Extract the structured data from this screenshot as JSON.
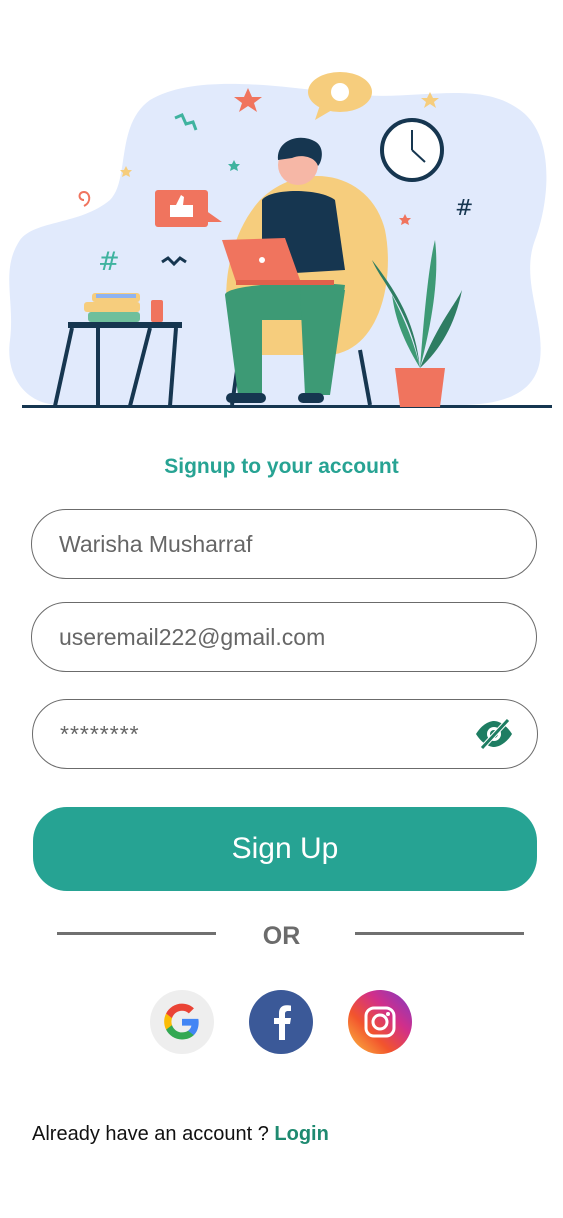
{
  "form": {
    "title": "Signup to your account",
    "name_value": "Warisha Musharraf",
    "email_value": "useremail222@gmail.com",
    "password_value": "********",
    "signup_label": "Sign Up",
    "or_label": "OR"
  },
  "social": {
    "google_icon": "google-icon",
    "facebook_icon": "facebook-icon",
    "instagram_icon": "instagram-icon"
  },
  "footer": {
    "prompt": "Already have an account ? ",
    "login_label": "Login"
  },
  "colors": {
    "accent": "#26a393",
    "link": "#1e8a70",
    "facebook": "#3b5998"
  }
}
